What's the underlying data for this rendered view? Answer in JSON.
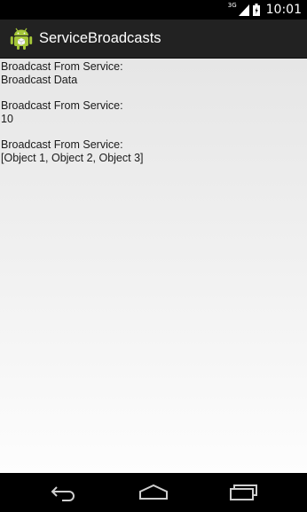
{
  "status_bar": {
    "network_type": "3G",
    "time": "10:01",
    "icons": [
      "signal-icon",
      "battery-icon"
    ]
  },
  "action_bar": {
    "app_icon": "android-icon",
    "title": "ServiceBroadcasts"
  },
  "messages": [
    {
      "label": "Broadcast From Service:",
      "value": "Broadcast Data"
    },
    {
      "label": "Broadcast From Service:",
      "value": "10"
    },
    {
      "label": "Broadcast From Service:",
      "value": "[Object 1, Object 2, Object 3]"
    }
  ],
  "nav_bar": {
    "icons": [
      "back-icon",
      "home-icon",
      "recent-apps-icon"
    ]
  }
}
